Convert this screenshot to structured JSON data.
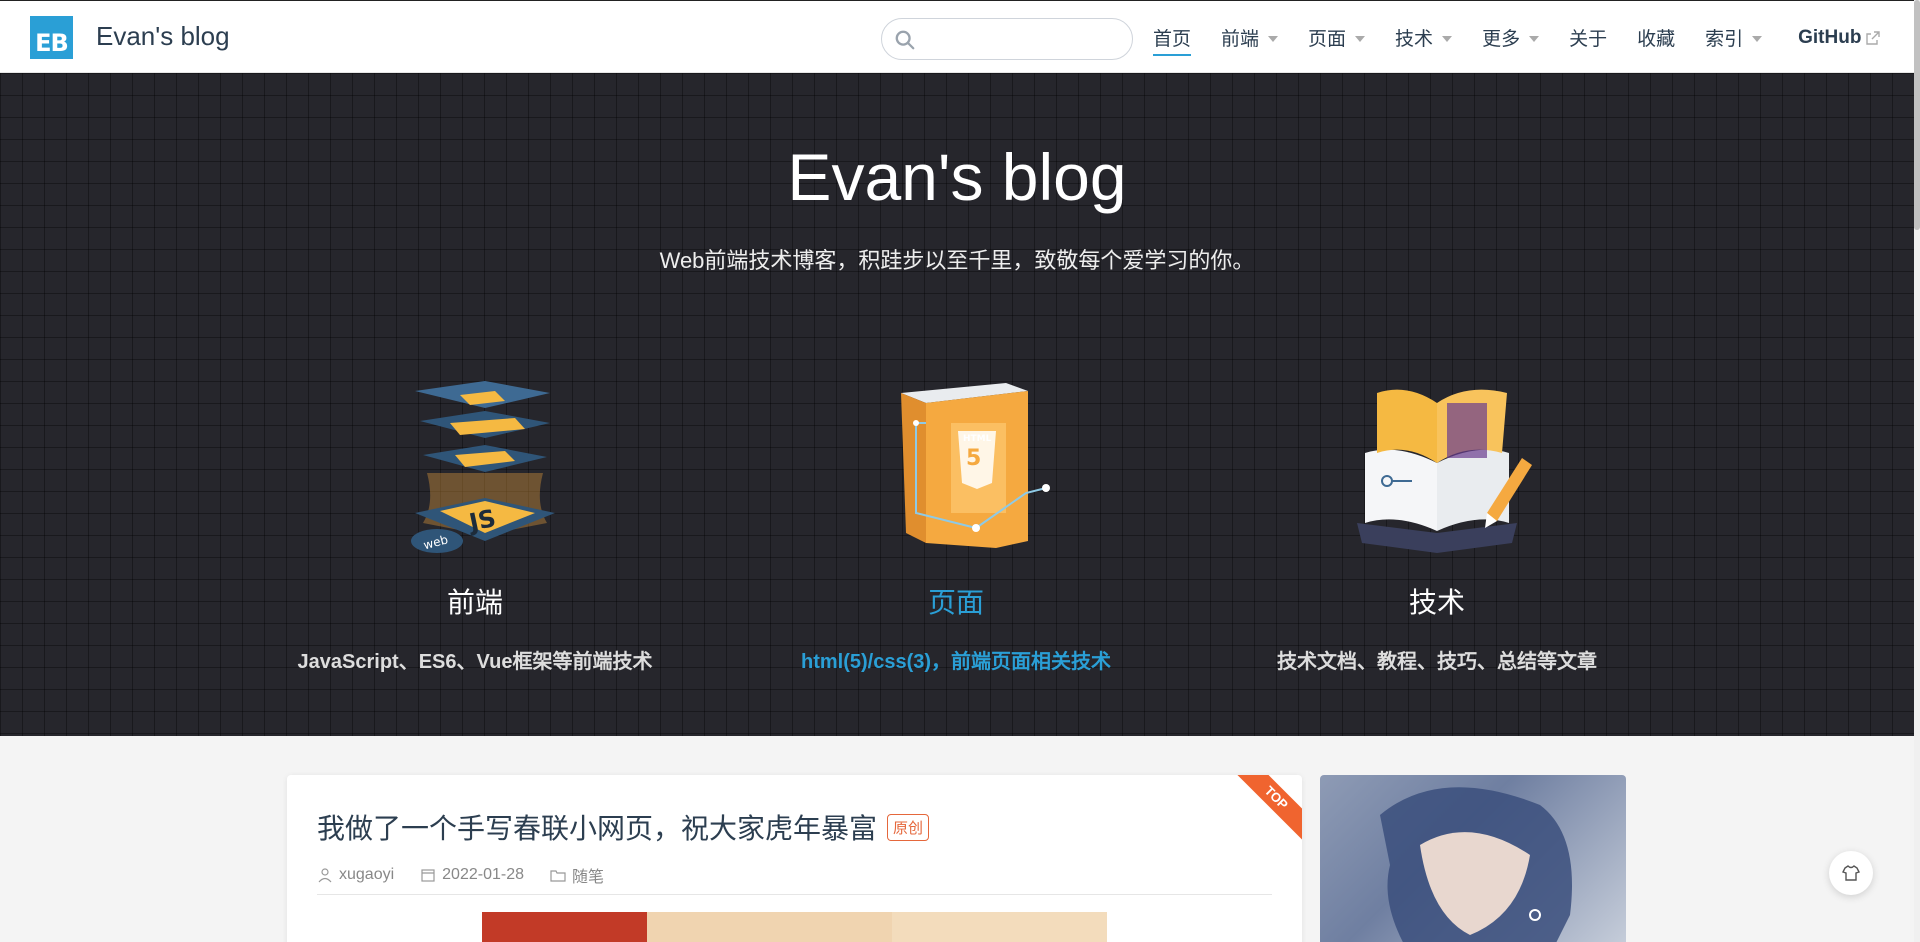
{
  "site": {
    "logo_text": "EB",
    "name": "Evan's blog"
  },
  "search": {
    "placeholder": "",
    "value": ""
  },
  "nav": {
    "items": [
      {
        "label": "首页",
        "has_dropdown": false,
        "active": true
      },
      {
        "label": "前端",
        "has_dropdown": true
      },
      {
        "label": "页面",
        "has_dropdown": true
      },
      {
        "label": "技术",
        "has_dropdown": true
      },
      {
        "label": "更多",
        "has_dropdown": true
      },
      {
        "label": "关于",
        "has_dropdown": false
      },
      {
        "label": "收藏",
        "has_dropdown": false
      },
      {
        "label": "索引",
        "has_dropdown": true
      }
    ],
    "github_label": "GitHub"
  },
  "hero": {
    "title": "Evan's blog",
    "description": "Web前端技术博客，积跬步以至千里，致敬每个爱学习的你。",
    "features": [
      {
        "title": "前端",
        "description": "JavaScript、ES6、Vue框架等前端技术",
        "icon": "js-layers-icon"
      },
      {
        "title": "页面",
        "description": "html(5)/css(3)，前端页面相关技术",
        "icon": "html5-page-icon",
        "active": true
      },
      {
        "title": "技术",
        "description": "技术文档、教程、技巧、总结等文章",
        "icon": "book-pencil-icon"
      }
    ]
  },
  "post": {
    "title": "我做了一个手写春联小网页，祝大家虎年暴富",
    "badge": "原创",
    "ribbon": "TOP",
    "author": "xugaoyi",
    "date": "2022-01-28",
    "category": "随笔"
  },
  "colors": {
    "accent": "#2a9fd6",
    "hero_bg": "#26262c",
    "badge": "#e5673b"
  }
}
